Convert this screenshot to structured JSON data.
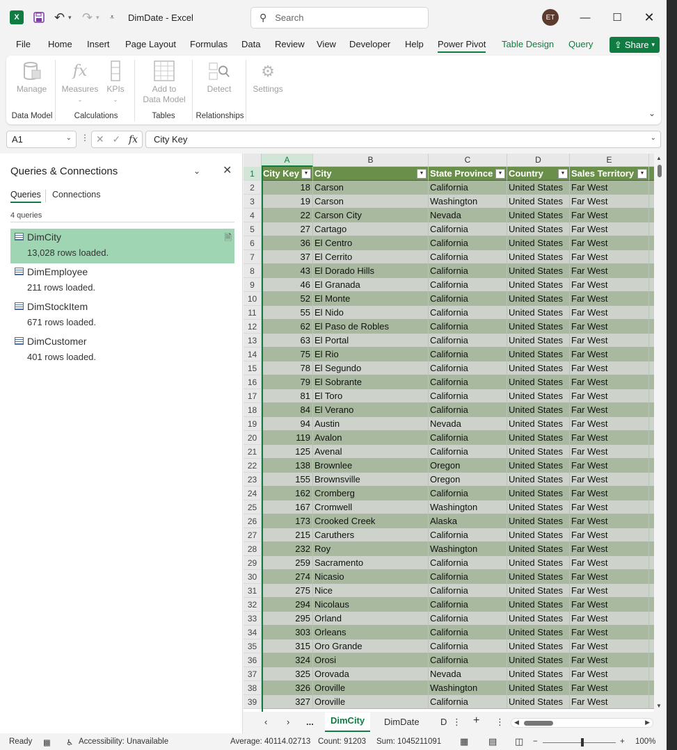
{
  "titlebar": {
    "app_logo": "X",
    "doc_title": "DimDate  -  Excel",
    "search_placeholder": "Search",
    "avatar_initials": "ET"
  },
  "menu_tabs": [
    "File",
    "Home",
    "Insert",
    "Page Layout",
    "Formulas",
    "Data",
    "Review",
    "View",
    "Developer",
    "Help",
    "Power Pivot",
    "Table Design",
    "Query"
  ],
  "share_label": "Share",
  "ribbon": {
    "manage": "Manage",
    "measures": "Measures",
    "kpis": "KPIs",
    "add_to": "Add to",
    "data_model": "Data Model",
    "detect": "Detect",
    "settings": "Settings",
    "groups": [
      "Data Model",
      "Calculations",
      "Tables",
      "Relationships"
    ]
  },
  "formula_bar": {
    "name_box": "A1",
    "formula": "City Key"
  },
  "queries_pane": {
    "title": "Queries & Connections",
    "tab_queries": "Queries",
    "tab_connections": "Connections",
    "count": "4 queries",
    "items": [
      {
        "name": "DimCity",
        "rows": "13,028 rows loaded."
      },
      {
        "name": "DimEmployee",
        "rows": "211 rows loaded."
      },
      {
        "name": "DimStockItem",
        "rows": "671 rows loaded."
      },
      {
        "name": "DimCustomer",
        "rows": "401 rows loaded."
      }
    ]
  },
  "grid": {
    "columns": [
      "A",
      "B",
      "C",
      "D",
      "E"
    ],
    "headers": [
      "City Key",
      "City",
      "State Province",
      "Country",
      "Sales Territory"
    ],
    "rows": [
      [
        "18",
        "Carson",
        "California",
        "United States",
        "Far West"
      ],
      [
        "19",
        "Carson",
        "Washington",
        "United States",
        "Far West"
      ],
      [
        "22",
        "Carson City",
        "Nevada",
        "United States",
        "Far West"
      ],
      [
        "27",
        "Cartago",
        "California",
        "United States",
        "Far West"
      ],
      [
        "36",
        "El Centro",
        "California",
        "United States",
        "Far West"
      ],
      [
        "37",
        "El Cerrito",
        "California",
        "United States",
        "Far West"
      ],
      [
        "43",
        "El Dorado Hills",
        "California",
        "United States",
        "Far West"
      ],
      [
        "46",
        "El Granada",
        "California",
        "United States",
        "Far West"
      ],
      [
        "52",
        "El Monte",
        "California",
        "United States",
        "Far West"
      ],
      [
        "55",
        "El Nido",
        "California",
        "United States",
        "Far West"
      ],
      [
        "62",
        "El Paso de Robles",
        "California",
        "United States",
        "Far West"
      ],
      [
        "63",
        "El Portal",
        "California",
        "United States",
        "Far West"
      ],
      [
        "75",
        "El Rio",
        "California",
        "United States",
        "Far West"
      ],
      [
        "78",
        "El Segundo",
        "California",
        "United States",
        "Far West"
      ],
      [
        "79",
        "El Sobrante",
        "California",
        "United States",
        "Far West"
      ],
      [
        "81",
        "El Toro",
        "California",
        "United States",
        "Far West"
      ],
      [
        "84",
        "El Verano",
        "California",
        "United States",
        "Far West"
      ],
      [
        "94",
        "Austin",
        "Nevada",
        "United States",
        "Far West"
      ],
      [
        "119",
        "Avalon",
        "California",
        "United States",
        "Far West"
      ],
      [
        "125",
        "Avenal",
        "California",
        "United States",
        "Far West"
      ],
      [
        "138",
        "Brownlee",
        "Oregon",
        "United States",
        "Far West"
      ],
      [
        "155",
        "Brownsville",
        "Oregon",
        "United States",
        "Far West"
      ],
      [
        "162",
        "Cromberg",
        "California",
        "United States",
        "Far West"
      ],
      [
        "167",
        "Cromwell",
        "Washington",
        "United States",
        "Far West"
      ],
      [
        "173",
        "Crooked Creek",
        "Alaska",
        "United States",
        "Far West"
      ],
      [
        "215",
        "Caruthers",
        "California",
        "United States",
        "Far West"
      ],
      [
        "232",
        "Roy",
        "Washington",
        "United States",
        "Far West"
      ],
      [
        "259",
        "Sacramento",
        "California",
        "United States",
        "Far West"
      ],
      [
        "274",
        "Nicasio",
        "California",
        "United States",
        "Far West"
      ],
      [
        "275",
        "Nice",
        "California",
        "United States",
        "Far West"
      ],
      [
        "294",
        "Nicolaus",
        "California",
        "United States",
        "Far West"
      ],
      [
        "295",
        "Orland",
        "California",
        "United States",
        "Far West"
      ],
      [
        "303",
        "Orleans",
        "California",
        "United States",
        "Far West"
      ],
      [
        "315",
        "Oro Grande",
        "California",
        "United States",
        "Far West"
      ],
      [
        "324",
        "Orosi",
        "California",
        "United States",
        "Far West"
      ],
      [
        "325",
        "Orovada",
        "Nevada",
        "United States",
        "Far West"
      ],
      [
        "326",
        "Oroville",
        "Washington",
        "United States",
        "Far West"
      ],
      [
        "327",
        "Oroville",
        "California",
        "United States",
        "Far West"
      ]
    ]
  },
  "sheets": {
    "active": "DimCity",
    "other": "DimDate",
    "more": "...",
    "ellipsis": "D"
  },
  "status": {
    "ready": "Ready",
    "accessibility": "Accessibility: Unavailable",
    "average": "Average: 40114.02713",
    "count": "Count: 91203",
    "sum": "Sum: 1045211091",
    "zoom": "100%"
  },
  "colors": {
    "accent": "#107c41",
    "header_row": "#6a8f4b",
    "band_dark": "#a9b9a0",
    "band_light": "#cdd3cb",
    "selected_query": "#9fd5b3"
  }
}
